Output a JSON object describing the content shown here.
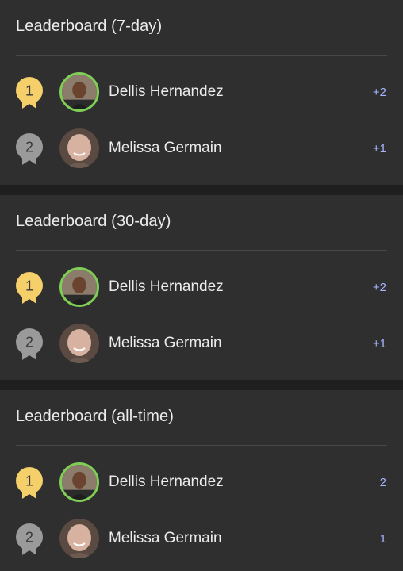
{
  "colors": {
    "gold_medal": "#f4cf6a",
    "silver_medal": "#9a9a9a",
    "score_text": "#a7b6ff",
    "avatar_ring": "#7fcf56"
  },
  "boards": [
    {
      "title": "Leaderboard (7-day)",
      "entries": [
        {
          "rank": "1",
          "name": "Dellis Hernandez",
          "score": "+2"
        },
        {
          "rank": "2",
          "name": "Melissa Germain",
          "score": "+1"
        }
      ]
    },
    {
      "title": "Leaderboard (30-day)",
      "entries": [
        {
          "rank": "1",
          "name": "Dellis Hernandez",
          "score": "+2"
        },
        {
          "rank": "2",
          "name": "Melissa Germain",
          "score": "+1"
        }
      ]
    },
    {
      "title": "Leaderboard (all-time)",
      "entries": [
        {
          "rank": "1",
          "name": "Dellis Hernandez",
          "score": "2"
        },
        {
          "rank": "2",
          "name": "Melissa Germain",
          "score": "1"
        }
      ]
    }
  ]
}
